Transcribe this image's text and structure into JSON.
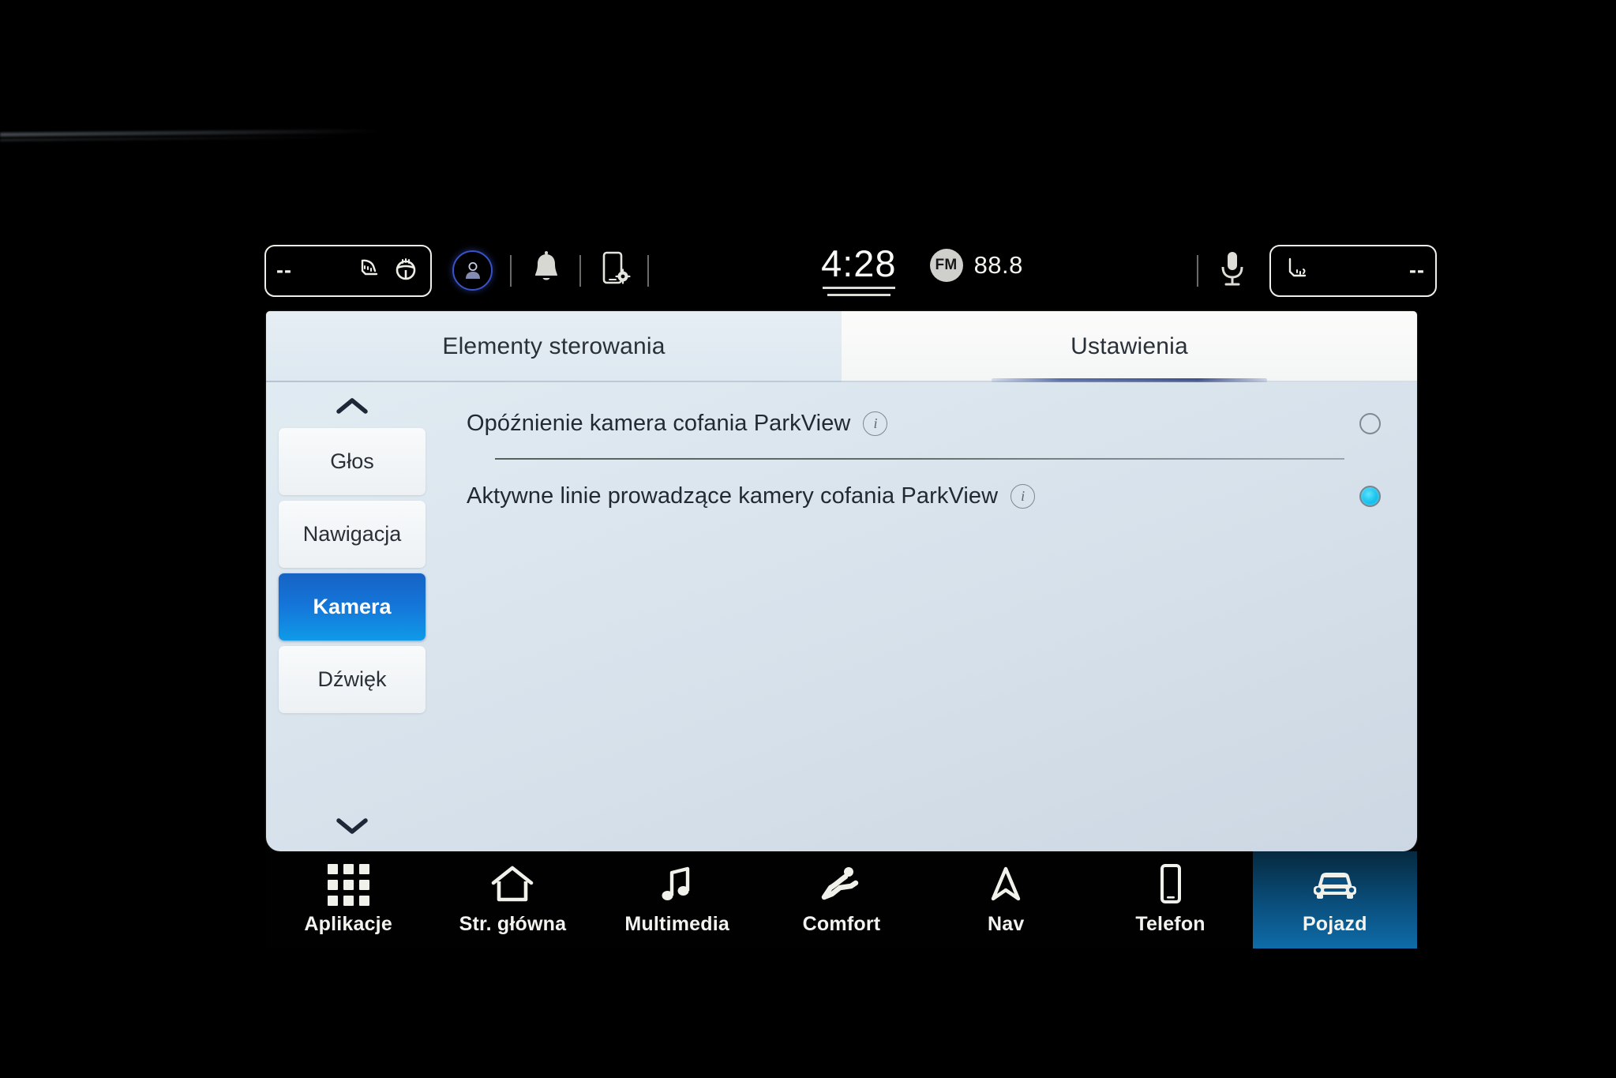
{
  "statusbar": {
    "left_box": {
      "value": "--",
      "icons": [
        "seat-heating-icon",
        "steering-wheel-heating-icon"
      ]
    },
    "profile_icon": "driver-profile-icon",
    "notification_icon": "bell-icon",
    "phone_settings_icon": "phone-settings-icon",
    "clock": "4:28",
    "radio": {
      "band": "FM",
      "frequency": "88.8"
    },
    "mic_icon": "microphone-icon",
    "right_box": {
      "value": "--",
      "icons": [
        "seat-heating-icon"
      ]
    }
  },
  "tabs": [
    {
      "label": "Elementy sterowania",
      "active": false
    },
    {
      "label": "Ustawienia",
      "active": true
    }
  ],
  "sidebar": {
    "scroll_up": "chevron-up-icon",
    "scroll_down": "chevron-down-icon",
    "items": [
      {
        "label": "Głos",
        "selected": false
      },
      {
        "label": "Nawigacja",
        "selected": false
      },
      {
        "label": "Kamera",
        "selected": true
      },
      {
        "label": "Dźwięk",
        "selected": false
      }
    ]
  },
  "settings": {
    "rows": [
      {
        "label": "Opóźnienie kamera cofania ParkView",
        "info": "i",
        "checked": false
      },
      {
        "label": "Aktywne linie prowadzące kamery cofania ParkView",
        "info": "i",
        "checked": true
      }
    ]
  },
  "navbar": {
    "items": [
      {
        "label": "Aplikacje",
        "icon": "apps-grid-icon",
        "active": false
      },
      {
        "label": "Str. główna",
        "icon": "home-icon",
        "active": false
      },
      {
        "label": "Multimedia",
        "icon": "music-note-icon",
        "active": false
      },
      {
        "label": "Comfort",
        "icon": "reclining-seat-icon",
        "active": false
      },
      {
        "label": "Nav",
        "icon": "navigation-arrow-icon",
        "active": false
      },
      {
        "label": "Telefon",
        "icon": "phone-icon",
        "active": false
      },
      {
        "label": "Pojazd",
        "icon": "car-front-icon",
        "active": true
      }
    ]
  },
  "colors": {
    "accent_blue": "#1574d8",
    "radio_on": "#16c3ee",
    "tab_underline": "#3f518f",
    "nav_active": "#0e6ca8"
  }
}
